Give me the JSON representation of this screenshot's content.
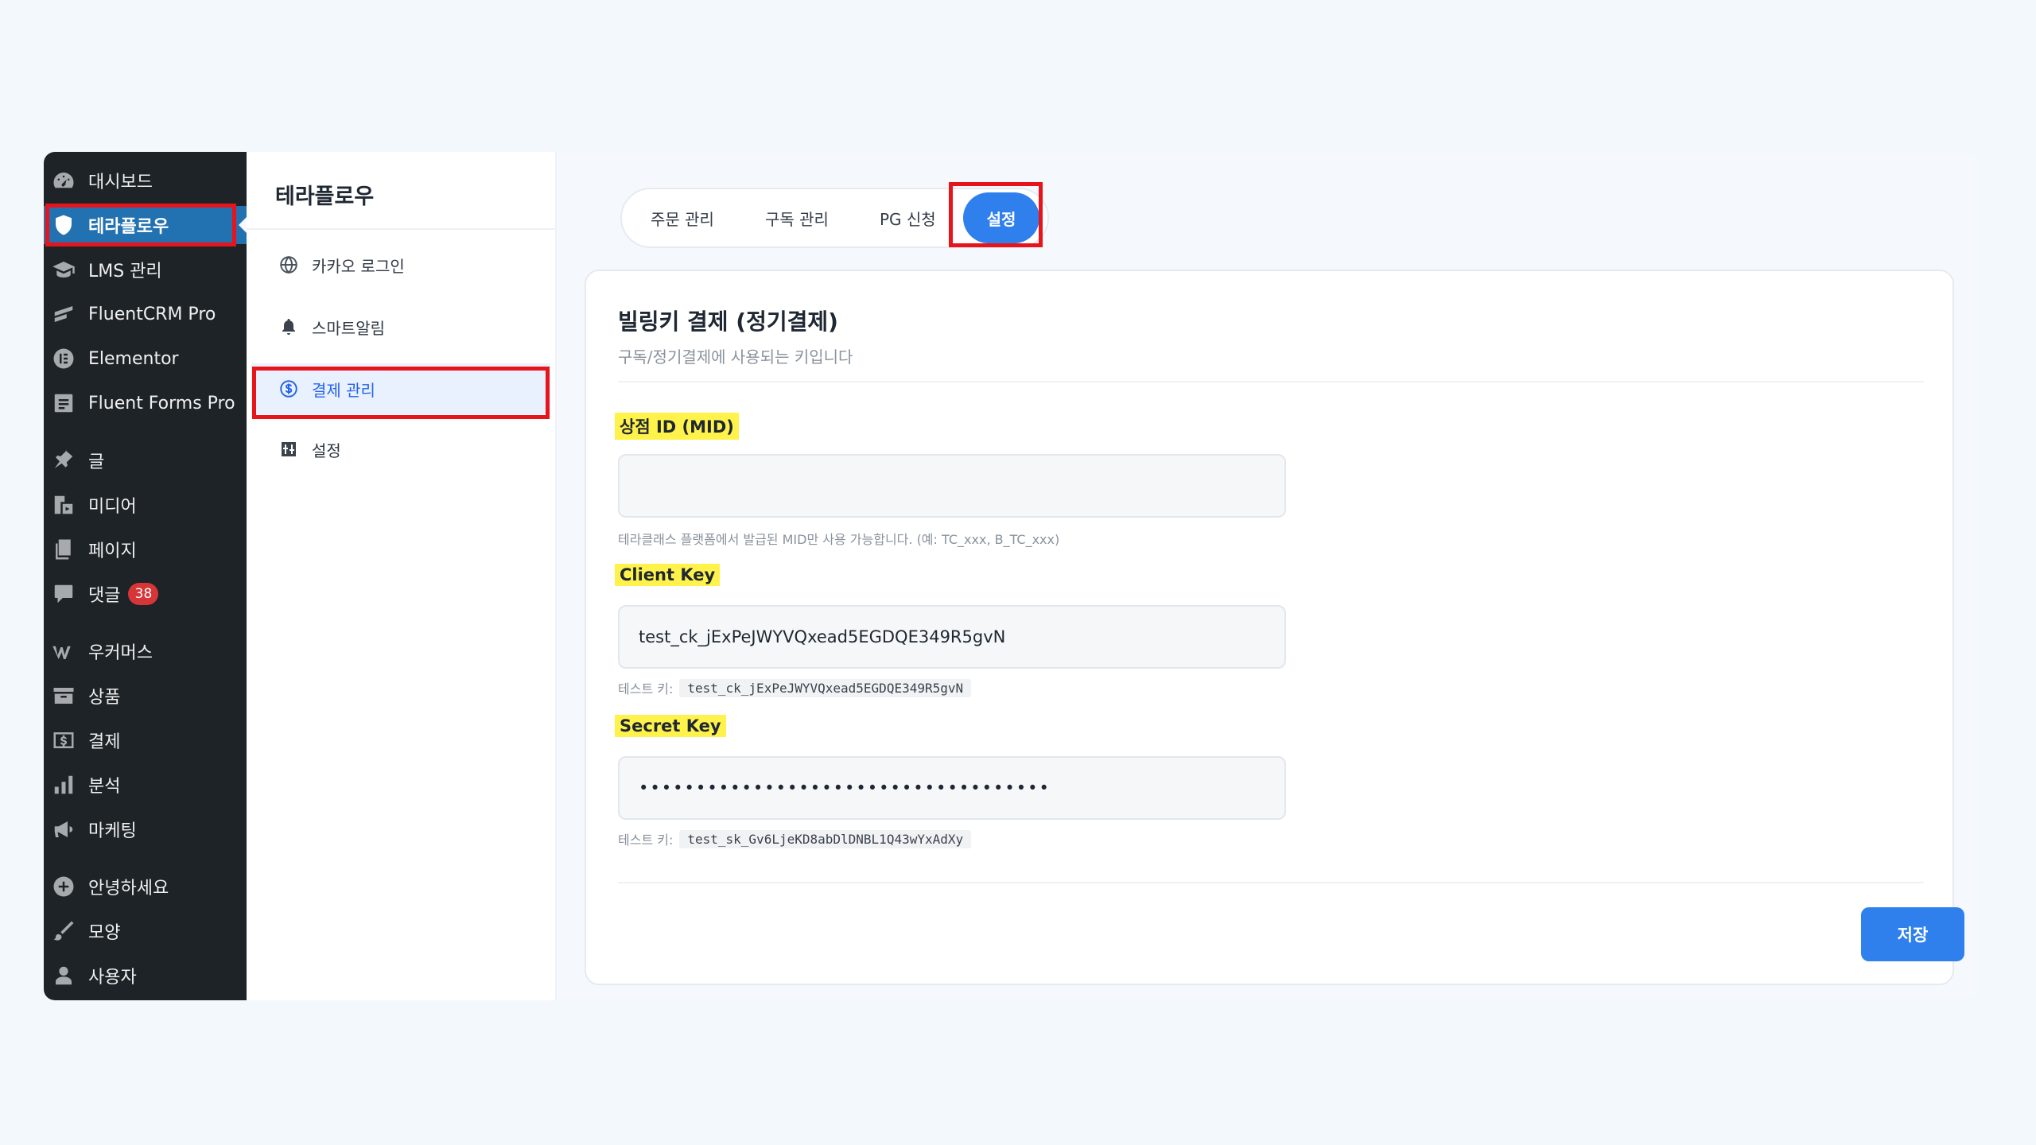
{
  "wp_menu": [
    {
      "label": "대시보드",
      "icon": "dashboard-icon"
    },
    {
      "label": "테라플로우",
      "icon": "shield-icon",
      "active": true
    },
    {
      "label": "LMS 관리",
      "icon": "graduation-cap-icon"
    },
    {
      "label": "FluentCRM Pro",
      "icon": "fluentcrm-icon"
    },
    {
      "label": "Elementor",
      "icon": "elementor-icon"
    },
    {
      "label": "Fluent Forms Pro",
      "icon": "forms-icon"
    },
    {
      "label": "글",
      "icon": "pin-icon"
    },
    {
      "label": "미디어",
      "icon": "media-icon"
    },
    {
      "label": "페이지",
      "icon": "page-icon"
    },
    {
      "label": "댓글",
      "icon": "comment-icon",
      "badge": "38"
    },
    {
      "label": "우커머스",
      "icon": "woocommerce-icon"
    },
    {
      "label": "상품",
      "icon": "archive-icon"
    },
    {
      "label": "결제",
      "icon": "dollar-icon"
    },
    {
      "label": "분석",
      "icon": "chart-bar-icon"
    },
    {
      "label": "마케팅",
      "icon": "megaphone-icon"
    },
    {
      "label": "안녕하세요",
      "icon": "plus-circle-icon"
    },
    {
      "label": "모양",
      "icon": "brush-icon"
    },
    {
      "label": "사용자",
      "icon": "user-icon"
    }
  ],
  "subnav": {
    "title": "테라플로우",
    "items": [
      {
        "label": "카카오 로그인",
        "icon": "globe-icon"
      },
      {
        "label": "스마트알림",
        "icon": "bell-icon"
      },
      {
        "label": "결제 관리",
        "icon": "dollar-circle-icon",
        "active": true
      },
      {
        "label": "설정",
        "icon": "settings-icon"
      }
    ]
  },
  "tabs": [
    {
      "label": "주문 관리"
    },
    {
      "label": "구독 관리"
    },
    {
      "label": "PG 신청"
    },
    {
      "label": "설정",
      "active": true
    }
  ],
  "card": {
    "title": "빌링키 결제 (정기결제)",
    "subtitle": "구독/정기결제에 사용되는 키입니다",
    "mid": {
      "label": "상점 ID (MID)",
      "value": "",
      "help": "테라클래스 플랫폼에서 발급된 MID만 사용 가능합니다. (예: TC_xxx, B_TC_xxx)"
    },
    "client_key": {
      "label": "Client Key",
      "value": "test_ck_jExPeJWYVQxead5EGDQE349R5gvN",
      "help_prefix": "테스트 키:",
      "help_code": "test_ck_jExPeJWYVQxead5EGDQE349R5gvN"
    },
    "secret_key": {
      "label": "Secret Key",
      "value": "••••••••••••••••••••••••••••••••••••",
      "help_prefix": "테스트 키:",
      "help_code": "test_sk_Gv6LjeKD8abDlDNBL1Q43wYxAdXy"
    },
    "save_label": "저장"
  },
  "colors": {
    "wp_sidebar_bg": "#1d2327",
    "wp_active": "#2271b1",
    "accent": "#2f80ed",
    "highlight": "#fff24a",
    "annotation_red": "#e8141c",
    "badge_red": "#d63638"
  }
}
